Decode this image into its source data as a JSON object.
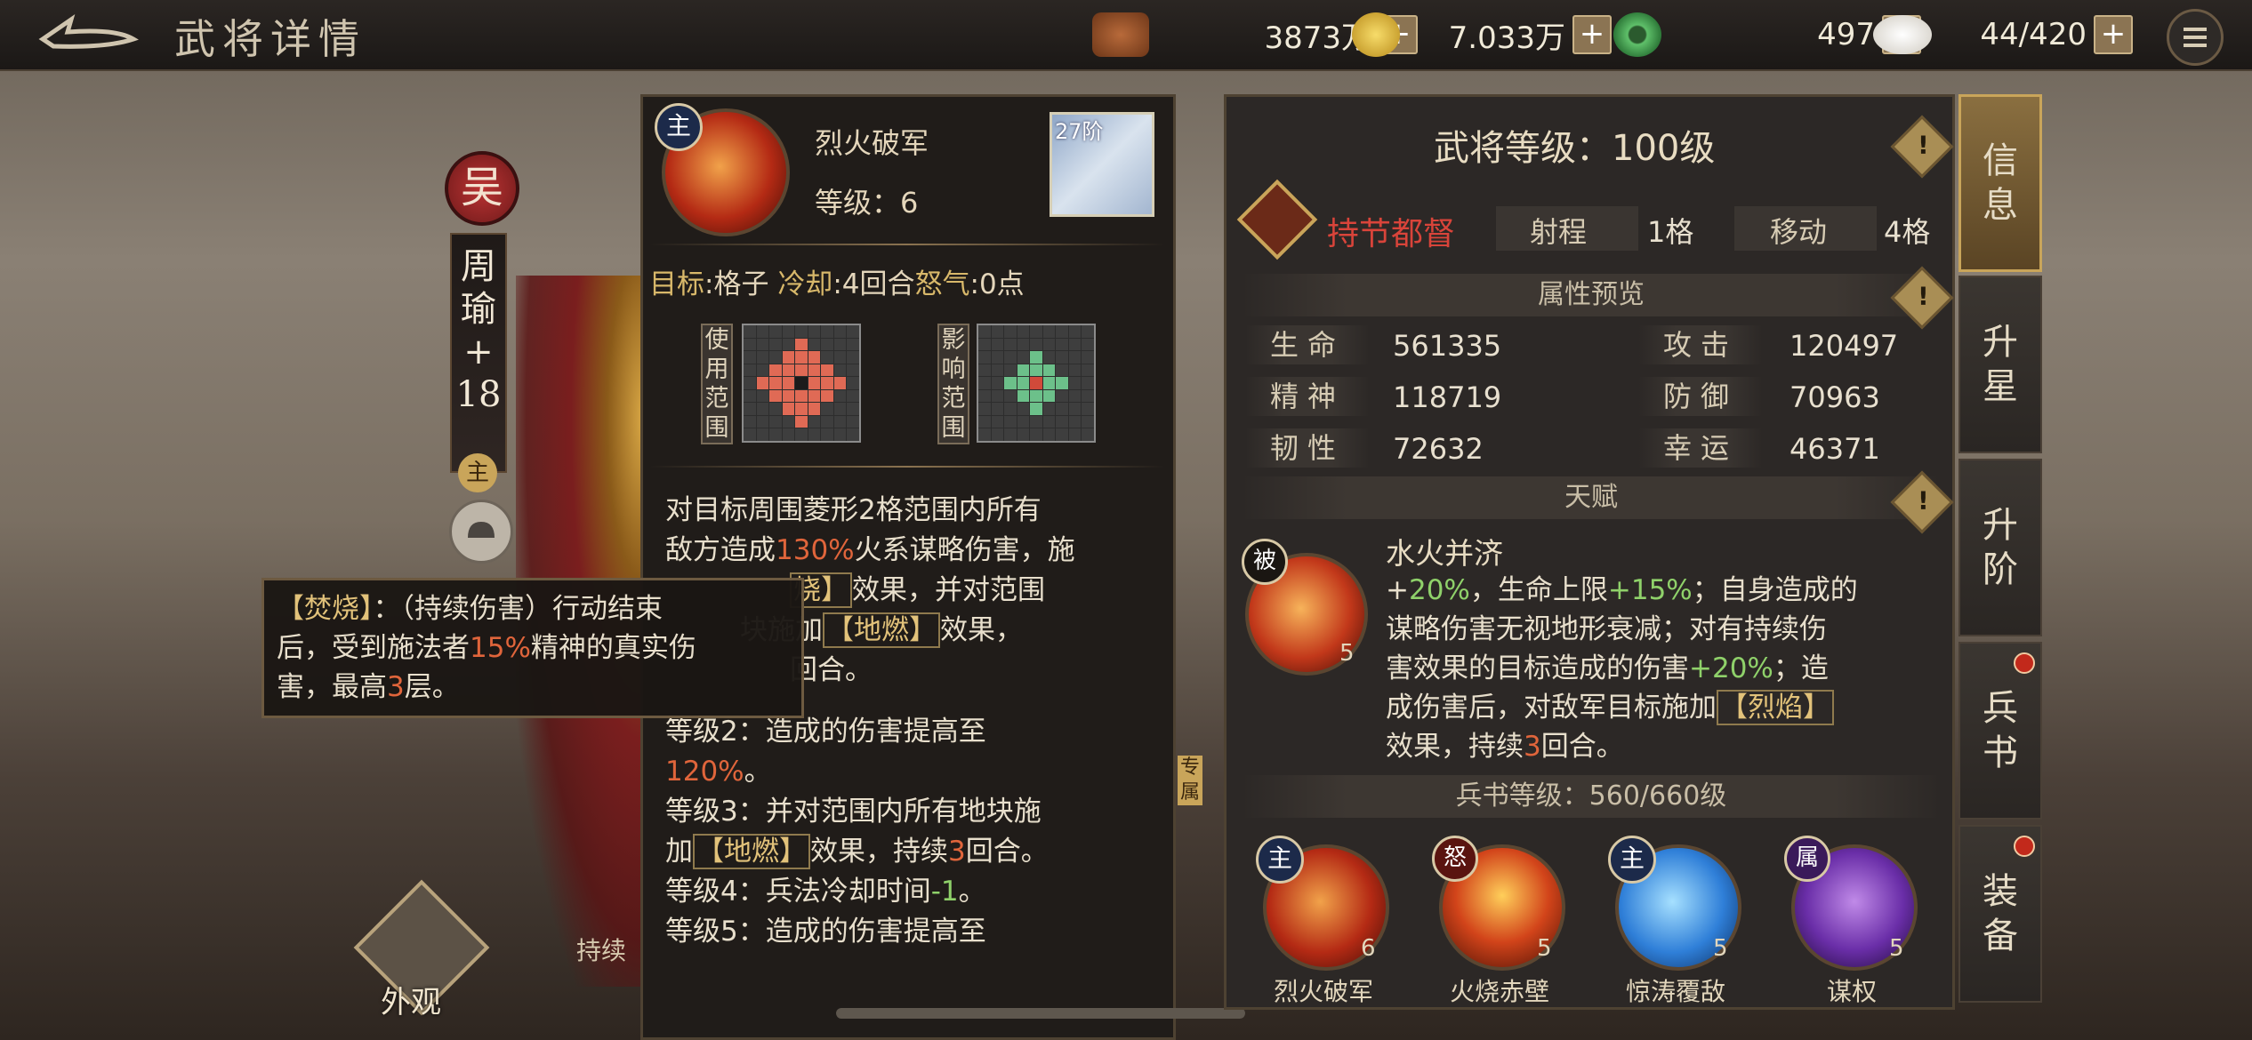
{
  "title": "武将详情",
  "resources": [
    {
      "icon": "copper-coin-stack-icon",
      "value": "3873万"
    },
    {
      "icon": "gold-coin-icon",
      "value": "7.033万"
    },
    {
      "icon": "jade-icon",
      "value": "497"
    },
    {
      "icon": "food-bun-icon",
      "value": "44/420"
    }
  ],
  "hero": {
    "faction": "吴",
    "name_chars": [
      "周",
      "瑜",
      "+",
      "18"
    ],
    "main_badge": "主"
  },
  "appearance_label": "外观",
  "continue_label": "持续",
  "skill": {
    "badge": "主",
    "name": "烈火破军",
    "level": "等级：6",
    "tier": "27阶",
    "meta": {
      "target_key": "目标",
      "target_val": "格子",
      "cooldown_key": "冷却",
      "cooldown_val": "4回合",
      "rage_key": "怒气",
      "rage_val": "0点"
    },
    "use_range_label": "使用范围",
    "effect_range_label": "影响范围",
    "desc": {
      "l1a": "对目标周围菱形2格范围内所有",
      "l2a": "敌方造成",
      "l2b": "130%",
      "l2c": "火系谋略伤害，施",
      "l3a": "",
      "l3b": "烧】",
      "l3c": "效果，并对范围",
      "l4a": "块施加",
      "l4b": "【地燃】",
      "l4c": "效果，",
      "l5": "回合。"
    },
    "levels": {
      "lv2": "等级2：造成的伤害提高至",
      "lv2b": "120%",
      "lv2c": "。",
      "lv3": "等级3：并对范围内所有地块施",
      "lv3b": "加",
      "lv3c": "【地燃】",
      "lv3d": "效果，持续",
      "lv3e": "3",
      "lv3f": "回合。",
      "lv4": "等级4：兵法冷却时间",
      "lv4b": "-1",
      "lv4c": "。",
      "lv5": "等级5：造成的伤害提高至"
    }
  },
  "tooltip": {
    "kw": "【焚烧】",
    "a": "：（持续伤害）行动结束",
    "b": "后，受到施法者",
    "c": "15%",
    "d": "精神的真实伤",
    "e": "害，最高",
    "f": "3",
    "g": "层。"
  },
  "info": {
    "hero_level": "武将等级：100级",
    "class_name": "持节都督",
    "range_label": "射程",
    "range_val": "1格",
    "move_label": "移动",
    "move_val": "4格",
    "attr_title": "属性预览",
    "stats": [
      {
        "label": "生命",
        "value": "561335"
      },
      {
        "label": "攻击",
        "value": "120497"
      },
      {
        "label": "精神",
        "value": "118719"
      },
      {
        "label": "防御",
        "value": "70963"
      },
      {
        "label": "韧性",
        "value": "72632"
      },
      {
        "label": "幸运",
        "value": "46371"
      }
    ],
    "talent_title": "天赋",
    "talent": {
      "badge": "被",
      "level": "5",
      "name": "水火并济",
      "t1a": "+",
      "t1b": "20%",
      "t1c": "，生命上限",
      "t1d": "+15%",
      "t1e": "；自身造成的",
      "t2": "谋略伤害无视地形衰减；对有持续伤",
      "t3a": "害效果的目标造成的伤害",
      "t3b": "+20%",
      "t3c": "；造",
      "t4a": "成伤害后，对敌军目标施加",
      "t4b": "【烈焰】",
      "t5a": "效果，持续",
      "t5b": "3",
      "t5c": "回合。"
    },
    "book_level": "兵书等级：560/660级",
    "book_skills": [
      {
        "badge": "主",
        "name": "烈火破军",
        "level": "6"
      },
      {
        "badge": "怒",
        "name": "火烧赤壁",
        "level": "5"
      },
      {
        "badge": "主",
        "name": "惊涛覆敌",
        "level": "5"
      },
      {
        "badge": "属",
        "name": "谋权",
        "level": "5"
      }
    ]
  },
  "tabs": [
    {
      "chars": [
        "信",
        "息"
      ],
      "active": true
    },
    {
      "chars": [
        "升",
        "星"
      ]
    },
    {
      "chars": [
        "升",
        "阶"
      ]
    },
    {
      "chars": [
        "兵",
        "书"
      ],
      "dot": true
    },
    {
      "chars": [
        "装",
        "备"
      ],
      "dot": true
    }
  ],
  "side_tag": "专属",
  "colors": {
    "accent": "#c9a55a",
    "damage": "#e0653b",
    "positive": "#8fd16a",
    "class_red": "#d9443a",
    "use_range": "#e06a55",
    "effect_range": "#6cc08a"
  }
}
